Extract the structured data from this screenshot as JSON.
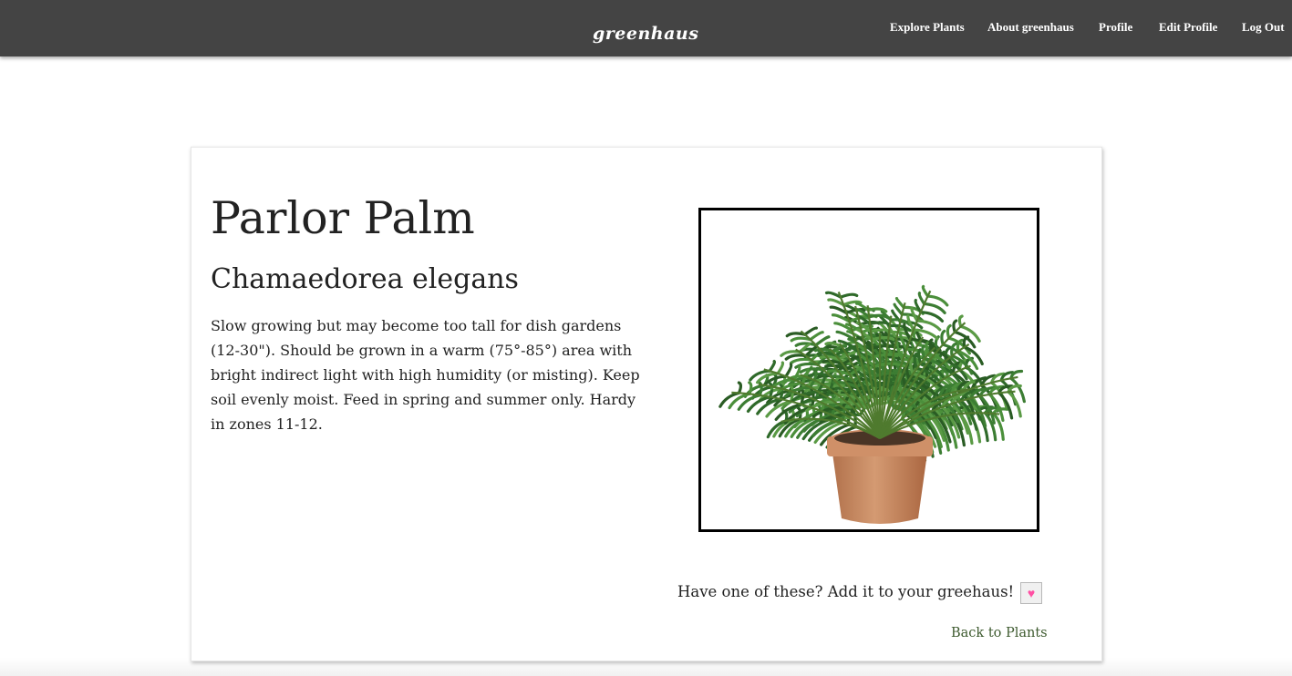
{
  "header": {
    "brand": "greenhaus",
    "nav": [
      {
        "label": "Explore Plants"
      },
      {
        "label": "About greenhaus"
      },
      {
        "label": "Profile"
      },
      {
        "label": "Edit Profile"
      },
      {
        "label": "Log Out"
      }
    ],
    "background_color": "#444444"
  },
  "plant": {
    "common_name": "Parlor Palm",
    "scientific_name": "Chamaedorea elegans",
    "description": "Slow growing but may become too tall for dish gardens (12-30\"). Should be grown in a warm (75°-85°) area with bright indirect light with high humidity (or misting). Keep soil evenly moist. Feed in spring and summer only. Hardy in zones 11-12.",
    "image_subject": "potted-parlor-palm"
  },
  "actions": {
    "add_prompt": "Have one of these? Add it to your greehaus!",
    "heart_icon": "heart-icon",
    "heart_color": "#ff4fa3",
    "back_label": "Back to Plants",
    "back_color": "#3d5a2e"
  }
}
